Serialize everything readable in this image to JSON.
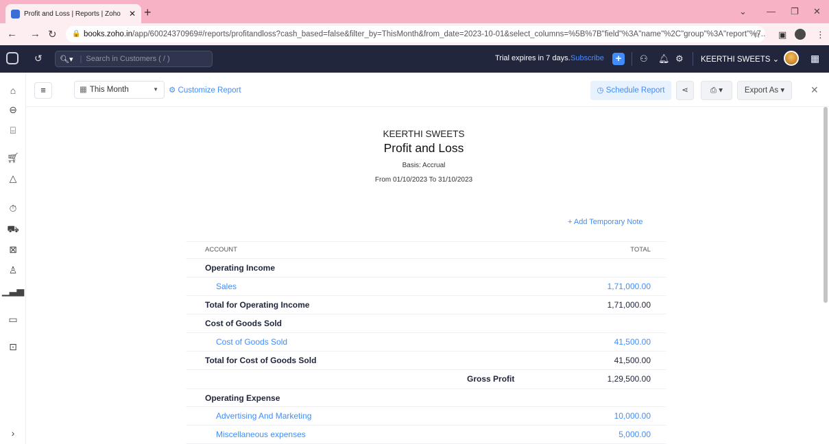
{
  "browser": {
    "tab_title": "Profit and Loss | Reports | Zoho",
    "url_host": "books.zoho.in",
    "url_path": "/app/60024370969#/reports/profitandloss?cash_based=false&filter_by=ThisMonth&from_date=2023-10-01&select_columns=%5B%7B\"field\"%3A\"name\"%2C\"group\"%3A\"report\"%7..."
  },
  "appbar": {
    "search_placeholder": "Search in Customers ( / )",
    "trial_text": "Trial expires in 7 days.",
    "subscribe_label": "Subscribe",
    "org_name": "KEERTHI SWEETS"
  },
  "toolbar": {
    "period_label": "This Month",
    "customize_label": "Customize Report",
    "schedule_label": "Schedule Report",
    "export_label": "Export As"
  },
  "report": {
    "org": "KEERTHI SWEETS",
    "title": "Profit and Loss",
    "basis": "Basis: Accrual",
    "range": "From 01/10/2023 To 31/10/2023",
    "add_note": "+ Add Temporary Note",
    "col_account": "ACCOUNT",
    "col_total": "TOTAL",
    "rows": [
      {
        "label": "Operating Income"
      },
      {
        "label": "Sales",
        "value": "1,71,000.00"
      },
      {
        "label": "Total for Operating Income",
        "value": "1,71,000.00"
      },
      {
        "label": "Cost of Goods Sold"
      },
      {
        "label": "Cost of Goods Sold",
        "value": "41,500.00"
      },
      {
        "label": "Total for Cost of Goods Sold",
        "value": "41,500.00"
      },
      {
        "label": "Gross Profit",
        "value": "1,29,500.00"
      },
      {
        "label": "Operating Expense"
      },
      {
        "label": "Advertising And Marketing",
        "value": "10,000.00"
      },
      {
        "label": "Miscellaneous expenses",
        "value": "5,000.00"
      }
    ]
  }
}
